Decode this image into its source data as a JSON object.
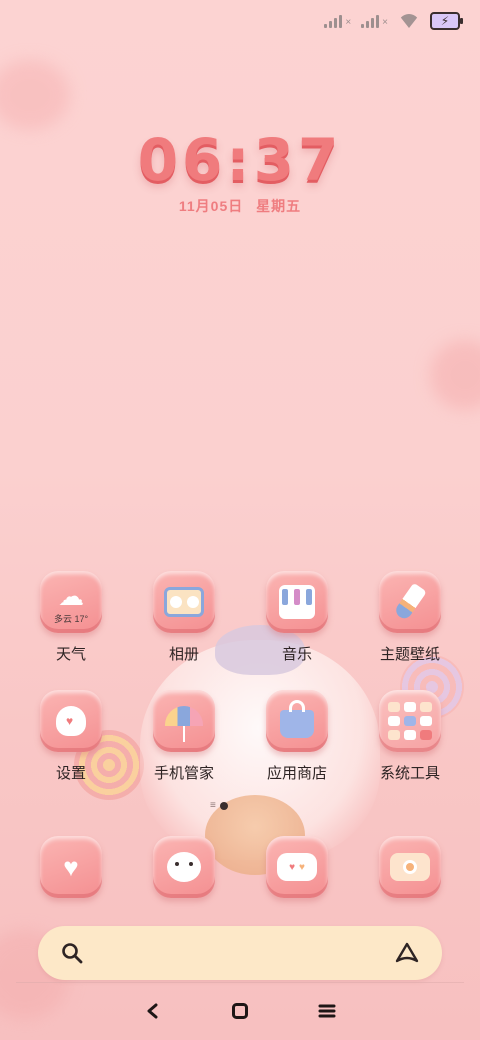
{
  "status_bar": {
    "signal_1_icon": "signal-no-service-icon",
    "signal_2_icon": "signal-no-service-icon",
    "wifi_icon": "wifi-icon",
    "battery_icon": "battery-charging-icon",
    "battery_color": "#d9c7f7"
  },
  "clock": {
    "time": "06:37",
    "date": "11月05日",
    "weekday": "星期五"
  },
  "apps": [
    {
      "label": "天气",
      "icon": "weather-cloud-icon",
      "badge_text": "多云 17°"
    },
    {
      "label": "相册",
      "icon": "gallery-photos-icon"
    },
    {
      "label": "音乐",
      "icon": "music-piano-icon"
    },
    {
      "label": "主题壁纸",
      "icon": "theme-paintbrush-icon"
    },
    {
      "label": "设置",
      "icon": "settings-icon"
    },
    {
      "label": "手机管家",
      "icon": "security-umbrella-icon"
    },
    {
      "label": "应用商店",
      "icon": "app-store-bag-icon"
    },
    {
      "label": "系统工具",
      "icon": "system-tools-folder-icon"
    }
  ],
  "dock": [
    {
      "icon": "phone-heart-icon"
    },
    {
      "icon": "contacts-bear-icon"
    },
    {
      "icon": "messages-bubble-icon"
    },
    {
      "icon": "camera-icon"
    }
  ],
  "search": {
    "search_icon": "search-icon",
    "assistant_icon": "assistant-triangle-icon",
    "background": "#fde8c8"
  },
  "nav": {
    "back": "back-icon",
    "home": "home-icon",
    "recents": "recents-icon"
  },
  "colors": {
    "accent": "#f07b7d",
    "icon_bg": "#f48f91"
  }
}
